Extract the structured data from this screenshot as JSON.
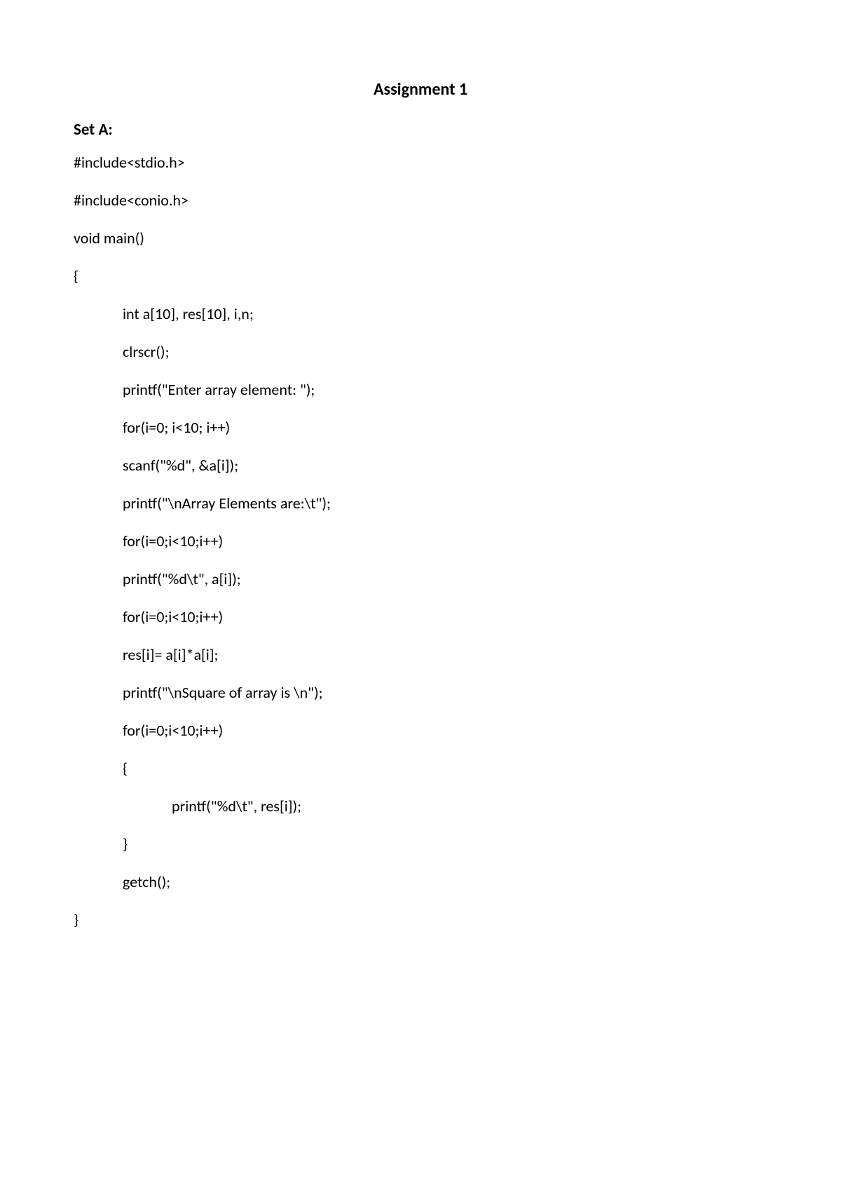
{
  "title": "Assignment 1",
  "set_label": "Set A:",
  "code": {
    "l01": "#include<stdio.h>",
    "l02": "#include<conio.h>",
    "l03": "void main()",
    "l04": "{",
    "l05": "int a[10], res[10], i,n;",
    "l06": "clrscr();",
    "l07": "printf(\"Enter array element: \");",
    "l08": "for(i=0; i<10; i++)",
    "l09": "scanf(\"%d\", &a[i]);",
    "l10": "printf(\"\\nArray Elements are:\\t\");",
    "l11": "for(i=0;i<10;i++)",
    "l12": "printf(\"%d\\t\", a[i]);",
    "l13": "for(i=0;i<10;i++)",
    "l14": "res[i]= a[i]*a[i];",
    "l15": "printf(\"\\nSquare of array is \\n\");",
    "l16": "for(i=0;i<10;i++)",
    "l17": "{",
    "l18": "printf(\"%d\\t\", res[i]);",
    "l19": "}",
    "l20": "getch();",
    "l21": "}"
  }
}
